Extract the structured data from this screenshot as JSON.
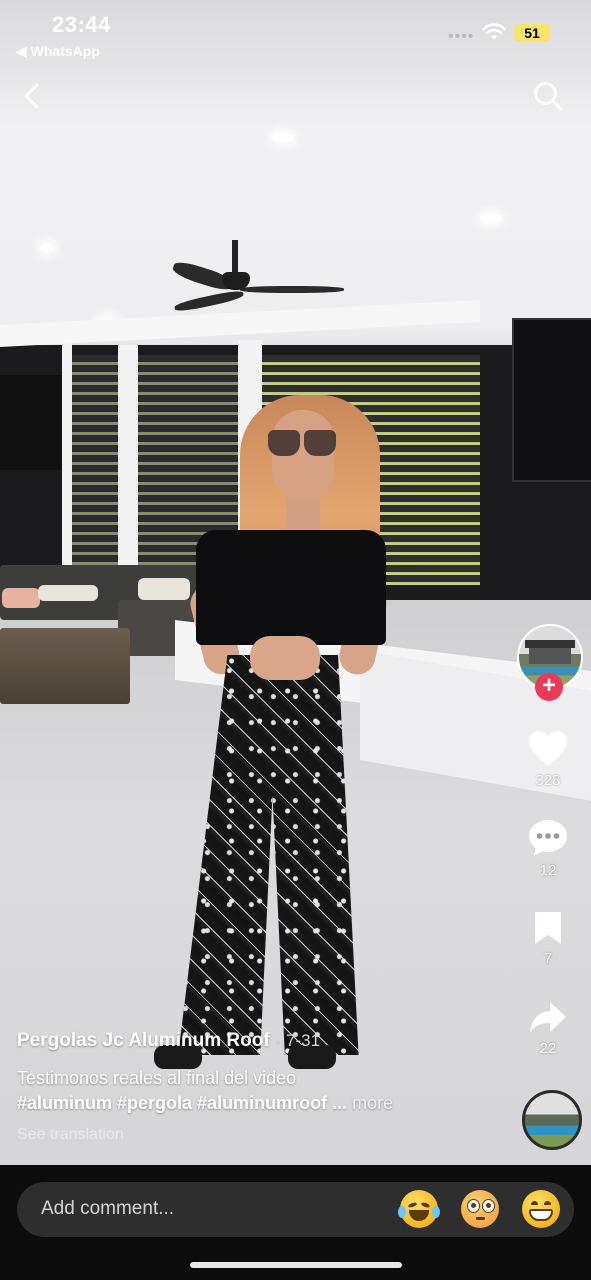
{
  "status_bar": {
    "time": "23:44",
    "back_app_label": "◀ WhatsApp",
    "signal_dots": "••••",
    "battery_level": "51",
    "battery_color": "#f6e56a"
  },
  "top_bar": {
    "back_icon": "chevron-left-icon",
    "search_icon": "search-icon"
  },
  "actions": {
    "follow_symbol": "+",
    "likes": "328",
    "comments": "12",
    "saves": "7",
    "shares": "22"
  },
  "caption": {
    "author": "Pergolas Jc Aluminum Roof",
    "date": "· 7-31",
    "description": "Testimonos reales al final del video",
    "hashtags": "#aluminum #pergola #aluminumroof ...",
    "more_label": "more",
    "translate_label": "See translation"
  },
  "comment_bar": {
    "placeholder": "Add comment...",
    "emojis": [
      "tears-of-joy-emoji",
      "flushed-face-emoji",
      "grinning-face-emoji"
    ]
  },
  "colors": {
    "accent_follow": "#ea3a55",
    "bottom_bar": "#0c0c0c",
    "comment_field": "#2e2e2f"
  }
}
